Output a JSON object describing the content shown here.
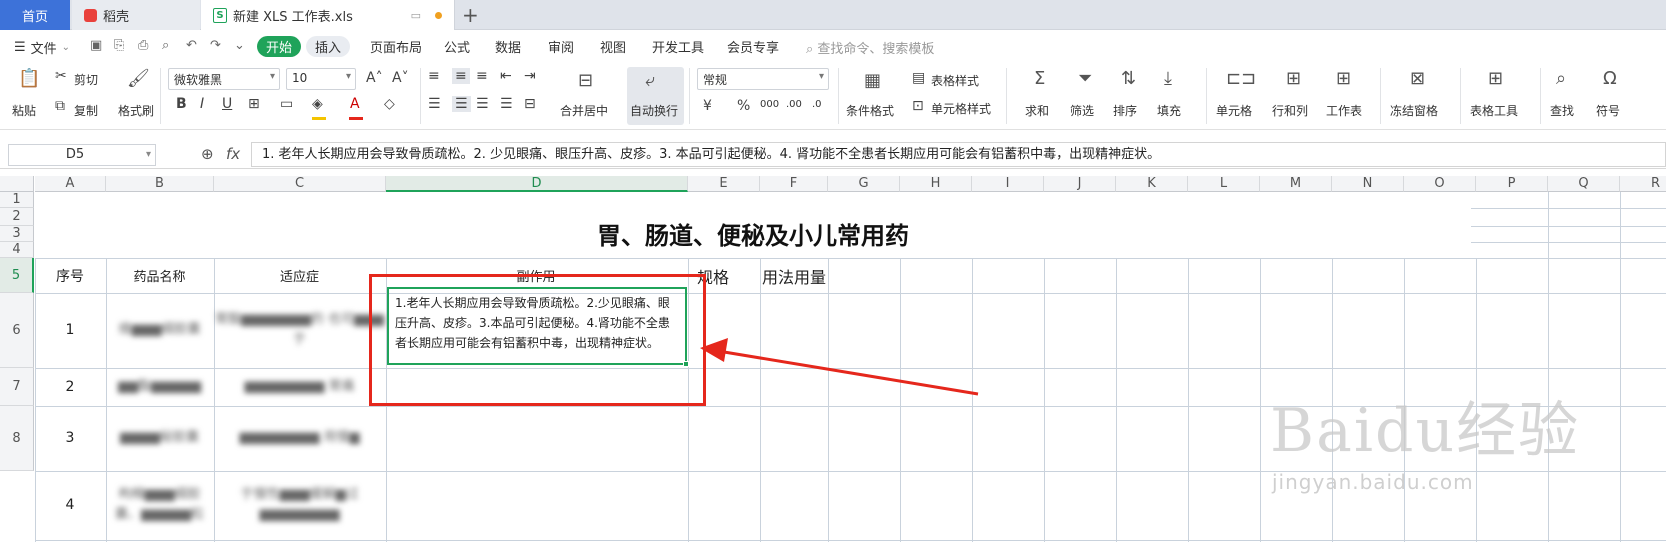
{
  "tabs": {
    "home": "首页",
    "daoke": "稻壳",
    "file": "新建 XLS 工作表.xls",
    "add": "+"
  },
  "menu": {
    "file": "文件",
    "items": [
      "开始",
      "插入",
      "页面布局",
      "公式",
      "数据",
      "审阅",
      "视图",
      "开发工具",
      "会员专享"
    ],
    "search": "查找命令、搜索模板"
  },
  "ribbon": {
    "paste": "粘贴",
    "cut": "剪切",
    "copy": "复制",
    "format_painter": "格式刷",
    "font": "微软雅黑",
    "font_size": "10",
    "merge": "合并居中",
    "wrap": "自动换行",
    "number_format": "常规",
    "cond_format": "条件格式",
    "table_style": "表格样式",
    "cell_style": "单元格样式",
    "sum": "求和",
    "filter": "筛选",
    "sort": "排序",
    "fill": "填充",
    "cell": "单元格",
    "row_col": "行和列",
    "worksheet": "工作表",
    "freeze": "冻结窗格",
    "table_tools": "表格工具",
    "find": "查找",
    "symbol": "符号",
    "bold": "B",
    "italic": "I",
    "underline": "U",
    "currency": "¥",
    "percent": "%"
  },
  "formula_bar": {
    "name_box": "D5",
    "fx": "fx",
    "content": "1. 老年人长期应用会导致骨质疏松。2. 少见眼痛、眼压升高、皮疹。3. 本品可引起便秘。4. 肾功能不全患者长期应用可能会有铝蓄积中毒，出现精神症状。"
  },
  "columns": [
    "A",
    "B",
    "C",
    "D",
    "E",
    "F",
    "G",
    "H",
    "I",
    "J",
    "K",
    "L",
    "M",
    "N",
    "O",
    "P",
    "Q",
    "R"
  ],
  "rows": [
    "1",
    "2",
    "3",
    "4",
    "5",
    "6",
    "7",
    "8"
  ],
  "sheet": {
    "title": "胃、肠道、便秘及小儿常用药",
    "headers": [
      "序号",
      "药品名称",
      "适应症",
      "副作用",
      "规格",
      "用法用量"
    ],
    "row_numbers": [
      "1",
      "2",
      "3",
      "4"
    ],
    "b5": "维▆▆▆细胶囊",
    "c5": "胃酸▆▆▆▆▆▆▆的 也可▆▆▆ 于",
    "b6": "▆▆酯▆▆▆▆▆",
    "c6": "▆▆▆▆▆▆▆▆ 胃痛",
    "b7": "▆▆▆▆秘胶囊",
    "c7": "▆▆▆▆▆▆▆▆ 用慢▆",
    "b8": "枸橼▆▆▆细胶囊、▆▆▆▆▆粒",
    "c8": "于慢性▆▆▆缓解▆过 ▆▆▆▆▆▆▆▆",
    "d5_text": "1.老年人长期应用会导致骨质疏松。2.少见眼痛、眼压升高、皮疹。3.本品可引起便秘。4.肾功能不全患者长期应用可能会有铝蓄积中毒，出现精神症状。"
  },
  "watermark": {
    "main": "Baidu经验",
    "url": "jingyan.baidu.com"
  },
  "colors": {
    "accent": "#1fa35a",
    "home_tab": "#3d72d9",
    "annotation": "#e5271c"
  }
}
